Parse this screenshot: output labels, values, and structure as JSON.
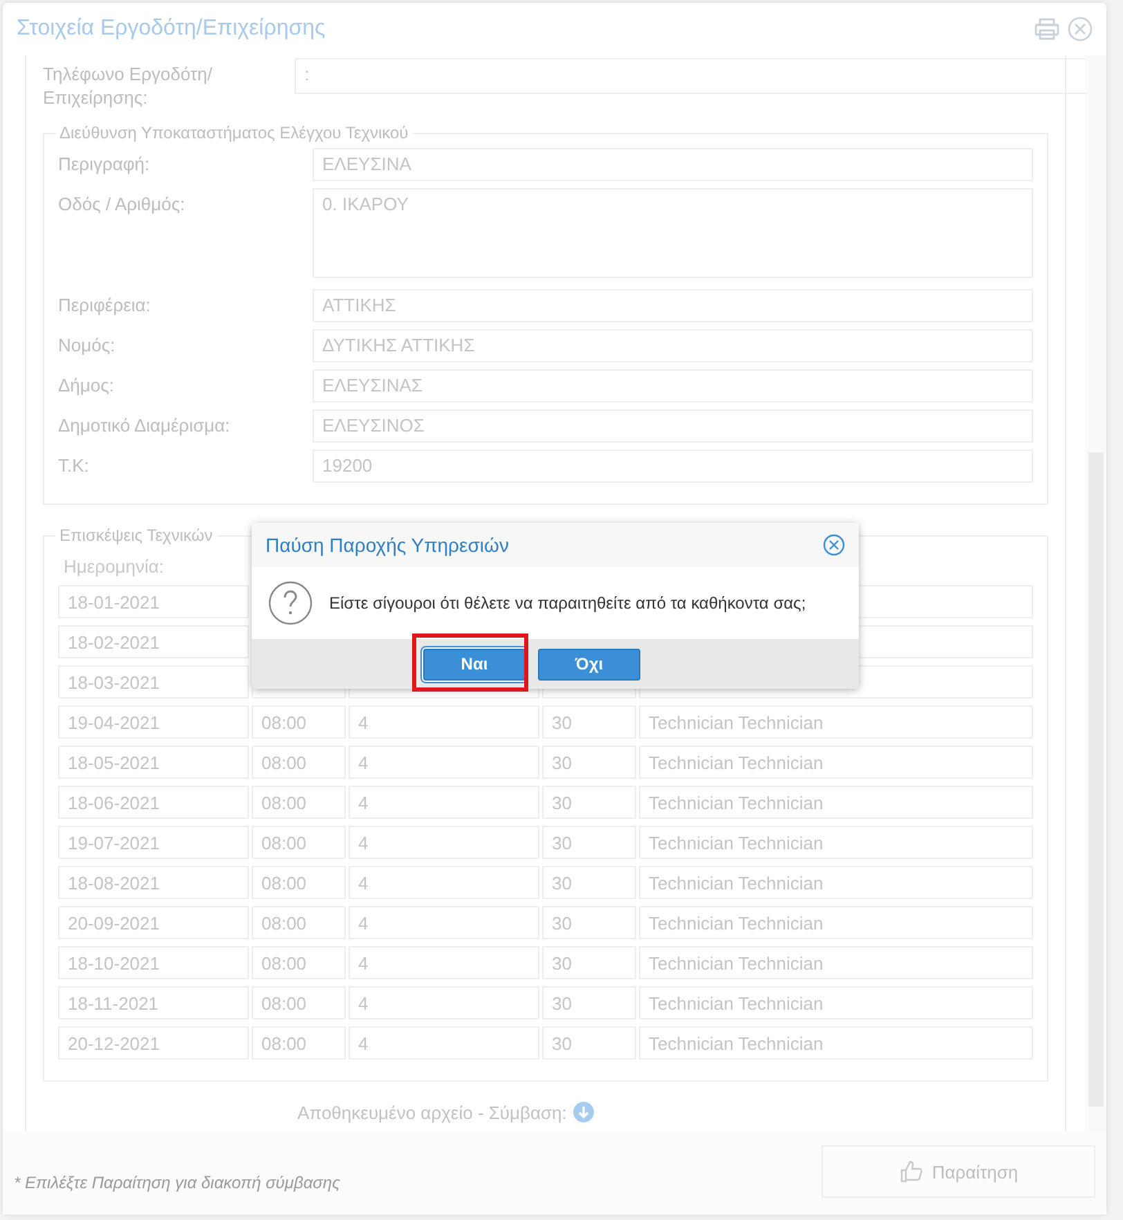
{
  "window": {
    "title": "Στοιχεία Εργοδότη/Επιχείρησης"
  },
  "phone": {
    "label": "Τηλέφωνο Εργοδότη/ Επιχείρησης:",
    "value": ":"
  },
  "address": {
    "legend": "Διεύθυνση Υποκαταστήματος Ελέγχου Τεχνικού",
    "fields": [
      {
        "label": "Περιγραφή:",
        "value": "ΕΛΕΥΣΙΝΑ",
        "kind": "line"
      },
      {
        "label": "Οδός / Αριθμός:",
        "value": "0. ΙΚΑΡΟΥ",
        "kind": "area"
      },
      {
        "label": "Περιφέρεια:",
        "value": "ΑΤΤΙΚΗΣ",
        "kind": "line"
      },
      {
        "label": "Νομός:",
        "value": "ΔΥΤΙΚΗΣ ΑΤΤΙΚΗΣ",
        "kind": "line"
      },
      {
        "label": "Δήμος:",
        "value": "ΕΛΕΥΣΙΝΑΣ",
        "kind": "line"
      },
      {
        "label": "Δημοτικό Διαμέρισμα:",
        "value": "ΕΛΕΥΣΙΝΟΣ",
        "kind": "line"
      },
      {
        "label": "Τ.Κ:",
        "value": "19200",
        "kind": "line"
      }
    ]
  },
  "visits": {
    "legend": "Επισκέψεις Τεχνικών",
    "columns": [
      "Ημερομηνία:"
    ],
    "rows": [
      [
        "18-01-2021",
        "",
        "",
        "",
        ""
      ],
      [
        "18-02-2021",
        "",
        "",
        "",
        ""
      ],
      [
        "18-03-2021",
        "",
        "",
        "",
        ""
      ],
      [
        "19-04-2021",
        "08:00",
        "4",
        "30",
        "Technician Technician"
      ],
      [
        "18-05-2021",
        "08:00",
        "4",
        "30",
        "Technician Technician"
      ],
      [
        "18-06-2021",
        "08:00",
        "4",
        "30",
        "Technician Technician"
      ],
      [
        "19-07-2021",
        "08:00",
        "4",
        "30",
        "Technician Technician"
      ],
      [
        "18-08-2021",
        "08:00",
        "4",
        "30",
        "Technician Technician"
      ],
      [
        "20-09-2021",
        "08:00",
        "4",
        "30",
        "Technician Technician"
      ],
      [
        "18-10-2021",
        "08:00",
        "4",
        "30",
        "Technician Technician"
      ],
      [
        "18-11-2021",
        "08:00",
        "4",
        "30",
        "Technician Technician"
      ],
      [
        "20-12-2021",
        "08:00",
        "4",
        "30",
        "Technician Technician"
      ]
    ]
  },
  "file": {
    "label": "Αποθηκευμένο αρχείο - Σύμβαση:"
  },
  "footer": {
    "note": "* Επιλέξτε Παραίτηση για διακοπή σύμβασης",
    "button": "Παραίτηση"
  },
  "dialog": {
    "title": "Παύση Παροχής Υπηρεσιών",
    "message": "Είστε σίγουροι ότι θέλετε να παραιτηθείτε από τα καθήκοντα σας;",
    "buttons": [
      {
        "label": "Ναι",
        "highlighted": true
      },
      {
        "label": "Όχι",
        "highlighted": false
      }
    ]
  }
}
